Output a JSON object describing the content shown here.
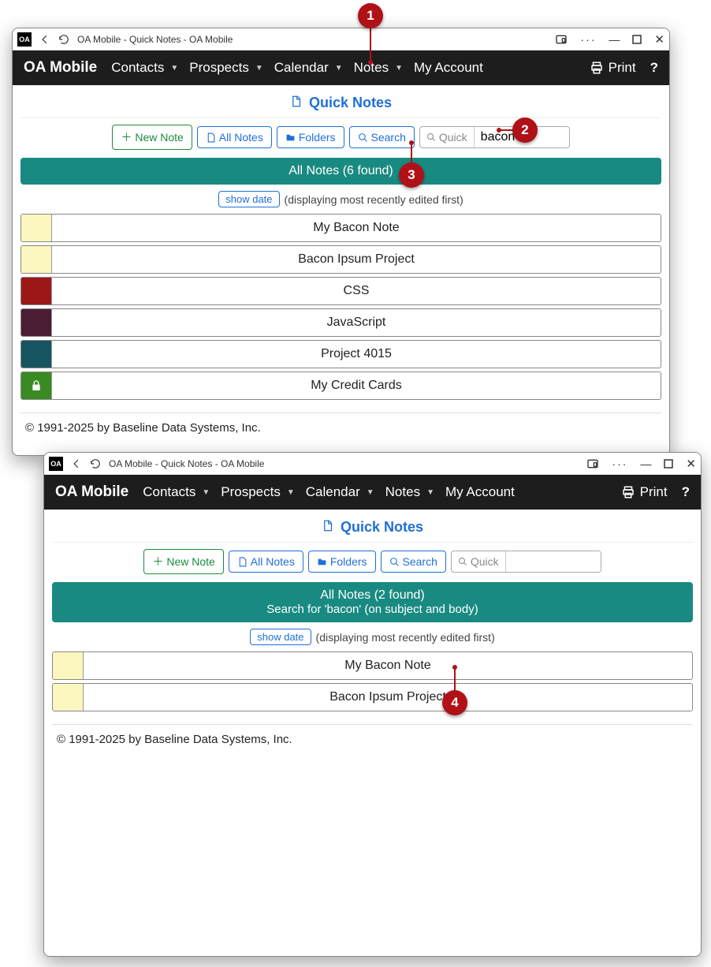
{
  "windowTop": {
    "titlebar": {
      "title": "OA Mobile - Quick Notes - OA Mobile",
      "appIcon": "OA"
    },
    "nav": {
      "brand": "OA Mobile",
      "items": [
        "Contacts",
        "Prospects",
        "Calendar",
        "Notes"
      ],
      "my_account": "My Account",
      "print": "Print",
      "help": "?"
    },
    "page_title": "Quick Notes",
    "toolbar": {
      "new_note": "New Note",
      "all_notes": "All Notes",
      "folders": "Folders",
      "search": "Search",
      "quick_label": "Quick",
      "quick_value": "bacon"
    },
    "results_header": "All Notes (6 found)",
    "show_date": "show date",
    "display_text": "(displaying most recently edited first)",
    "notes": [
      {
        "title": "My Bacon Note",
        "color": "#fbf7bf",
        "locked": false
      },
      {
        "title": "Bacon Ipsum Project",
        "color": "#fbf7bf",
        "locked": false
      },
      {
        "title": "CSS",
        "color": "#9c1717",
        "locked": false
      },
      {
        "title": "JavaScript",
        "color": "#4a1d35",
        "locked": false
      },
      {
        "title": "Project 4015",
        "color": "#16555f",
        "locked": false
      },
      {
        "title": "My Credit Cards",
        "color": "#3a8a23",
        "locked": true
      }
    ],
    "copyright": "© 1991-2025 by Baseline Data Systems, Inc."
  },
  "windowBottom": {
    "titlebar": {
      "title": "OA Mobile - Quick Notes - OA Mobile",
      "appIcon": "OA"
    },
    "nav": {
      "brand": "OA Mobile",
      "items": [
        "Contacts",
        "Prospects",
        "Calendar",
        "Notes"
      ],
      "my_account": "My Account",
      "print": "Print",
      "help": "?"
    },
    "page_title": "Quick Notes",
    "toolbar": {
      "new_note": "New Note",
      "all_notes": "All Notes",
      "folders": "Folders",
      "search": "Search",
      "quick_label": "Quick",
      "quick_value": ""
    },
    "results_header_line1": "All Notes (2 found)",
    "results_header_line2": "Search for 'bacon' (on subject and body)",
    "show_date": "show date",
    "display_text": "(displaying most recently edited first)",
    "notes": [
      {
        "title": "My Bacon Note",
        "color": "#fbf7bf",
        "locked": false
      },
      {
        "title": "Bacon Ipsum Project",
        "color": "#fbf7bf",
        "locked": false
      }
    ],
    "copyright": "© 1991-2025 by Baseline Data Systems, Inc."
  },
  "annotations": {
    "b1": "1",
    "b2": "2",
    "b3": "3",
    "b4": "4"
  }
}
